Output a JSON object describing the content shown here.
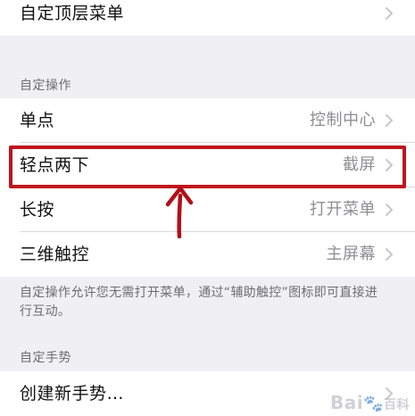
{
  "top_group": {
    "items": [
      {
        "label": "自定顶层菜单",
        "value": ""
      }
    ]
  },
  "custom_actions": {
    "header": "自定操作",
    "items": [
      {
        "label": "单点",
        "value": "控制中心"
      },
      {
        "label": "轻点两下",
        "value": "截屏"
      },
      {
        "label": "长按",
        "value": "打开菜单"
      },
      {
        "label": "三维触控",
        "value": "主屏幕"
      }
    ],
    "footer_line1": "自定操作允许您无需打开菜单，通过“辅助触控”图标即可直接进",
    "footer_line2": "行互动。"
  },
  "custom_gestures": {
    "header": "自定手势",
    "items": [
      {
        "label": "创建新手势…",
        "value": ""
      }
    ]
  },
  "annotation": {
    "highlight_color": "#c0141c"
  },
  "watermark": {
    "text": "Bai",
    "suffix": "百科"
  },
  "icons": {
    "chevron": "chevron-right-icon",
    "arrow": "arrow-up-icon",
    "watermark_paw": "paw-icon"
  }
}
